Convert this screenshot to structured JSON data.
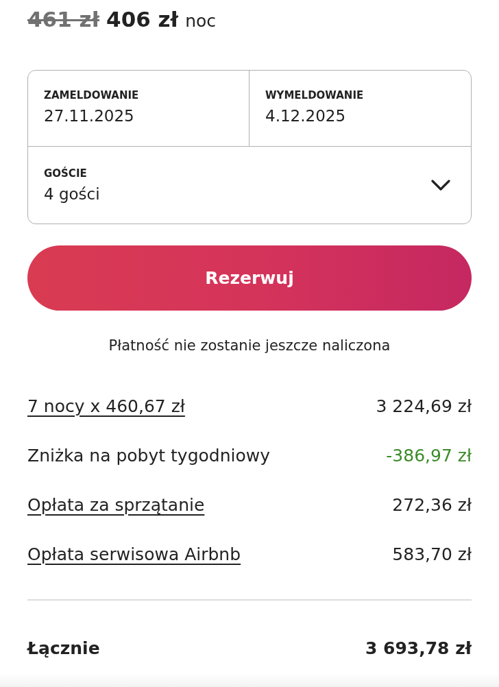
{
  "price": {
    "old": "461 zł",
    "current": "406 zł",
    "unit": "noc"
  },
  "booking": {
    "dates": [
      {
        "label": "ZAMELDOWANIE",
        "value": "27.11.2025"
      },
      {
        "label": "WYMELDOWANIE",
        "value": "4.12.2025"
      }
    ],
    "guests": {
      "label": "GOŚCIE",
      "value": "4 gości",
      "expanded": false
    }
  },
  "reserve_button": "Rezerwuj",
  "note": "Płatność nie zostanie jeszcze naliczona",
  "breakdown": [
    {
      "kind": "link",
      "label": "7 nocy x 460,67 zł",
      "amount": "3 224,69 zł"
    },
    {
      "kind": "discount",
      "label": "Zniżka na pobyt tygodniowy",
      "amount": "-386,97 zł"
    },
    {
      "kind": "link",
      "label": "Opłata za sprzątanie",
      "amount": "272,36 zł"
    },
    {
      "kind": "link",
      "label": "Opłata serwisowa Airbnb",
      "amount": "583,70 zł"
    }
  ],
  "total": {
    "label": "Łącznie",
    "amount": "3 693,78 zł"
  }
}
